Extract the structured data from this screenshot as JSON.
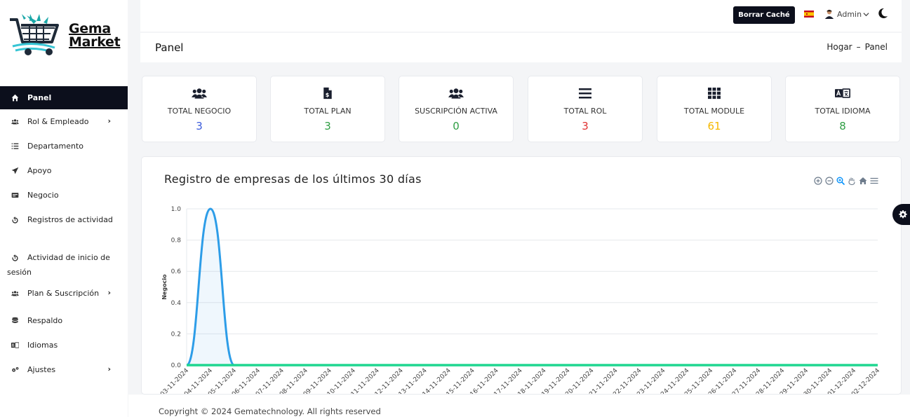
{
  "brand": {
    "line1": "Gema",
    "line2": "Market"
  },
  "sidebar": {
    "items": [
      {
        "label": "Panel",
        "icon": "home-icon",
        "active": true
      },
      {
        "label": "Rol & Empleado",
        "icon": "users-icon",
        "chevron": "›"
      },
      {
        "label": "Departamento",
        "icon": "list-icon"
      },
      {
        "label": "Apoyo",
        "icon": "send-icon"
      },
      {
        "label": "Negocio",
        "icon": "business-icon"
      },
      {
        "label": "Registros de actividad",
        "icon": "history-icon"
      },
      {
        "label": "Actividad de inicio de sesión",
        "icon": "history-icon"
      },
      {
        "label": "Plan & Suscripción",
        "icon": "users-icon",
        "chevron": "›"
      },
      {
        "label": "Respaldo",
        "icon": "database-icon"
      },
      {
        "label": "Idiomas",
        "icon": "language-icon"
      },
      {
        "label": "Ajustes",
        "icon": "gears-icon",
        "chevron": "›"
      }
    ]
  },
  "topbar": {
    "clear_cache_label": "Borrar Caché",
    "user_label": "Admin"
  },
  "page": {
    "title": "Panel",
    "breadcrumb": [
      "Hogar",
      "Panel"
    ],
    "breadcrumb_sep": "–"
  },
  "cards": [
    {
      "label": "TOTAL NEGOCIO",
      "value": "3",
      "icon": "users-icon",
      "color": "#3b5bdb"
    },
    {
      "label": "TOTAL PLAN",
      "value": "3",
      "icon": "invoice-icon",
      "color": "#2f9e44"
    },
    {
      "label": "SUSCRIPCIÓN ACTIVA",
      "value": "0",
      "icon": "users-icon",
      "color": "#2f9e44"
    },
    {
      "label": "TOTAL ROL",
      "value": "3",
      "icon": "bars-icon",
      "color": "#e03131"
    },
    {
      "label": "TOTAL MODULE",
      "value": "61",
      "icon": "grid-icon",
      "color": "#f5b800"
    },
    {
      "label": "TOTAL IDIOMA",
      "value": "8",
      "icon": "language-icon",
      "color": "#2f9e44"
    }
  ],
  "chart_panel": {
    "title": "Registro de empresas de los últimos 30 días"
  },
  "chart_data": {
    "type": "area",
    "ylabel": "Negocio",
    "ylim": [
      0,
      1
    ],
    "yticks": [
      "1.0",
      "0.8",
      "0.6",
      "0.4",
      "0.2",
      "0.0"
    ],
    "grid": true,
    "categories": [
      "03-11-2024",
      "04-11-2024",
      "05-11-2024",
      "06-11-2024",
      "07-11-2024",
      "08-11-2024",
      "09-11-2024",
      "10-11-2024",
      "11-11-2024",
      "12-11-2024",
      "13-11-2024",
      "14-11-2024",
      "15-11-2024",
      "16-11-2024",
      "17-11-2024",
      "18-11-2024",
      "19-11-2024",
      "20-11-2024",
      "21-11-2024",
      "22-11-2024",
      "23-11-2024",
      "24-11-2024",
      "25-11-2024",
      "26-11-2024",
      "27-11-2024",
      "28-11-2024",
      "29-11-2024",
      "30-11-2024",
      "01-12-2024",
      "02-12-2024"
    ],
    "series": [
      {
        "color": "#2d9de8",
        "values": [
          0,
          1,
          0,
          0,
          0,
          0,
          0,
          0,
          0,
          0,
          0,
          0,
          0,
          0,
          0,
          0,
          0,
          0,
          0,
          0,
          0,
          0,
          0,
          0,
          0,
          0,
          0,
          0,
          0,
          0
        ]
      },
      {
        "color": "#1fd690",
        "values": [
          0,
          0,
          0,
          0,
          0,
          0,
          0,
          0,
          0,
          0,
          0,
          0,
          0,
          0,
          0,
          0,
          0,
          0,
          0,
          0,
          0,
          0,
          0,
          0,
          0,
          0,
          0,
          0,
          0,
          0
        ]
      }
    ]
  },
  "footer": {
    "copyright": "Copyright © 2024 Gematechnology. All rights reserved"
  }
}
